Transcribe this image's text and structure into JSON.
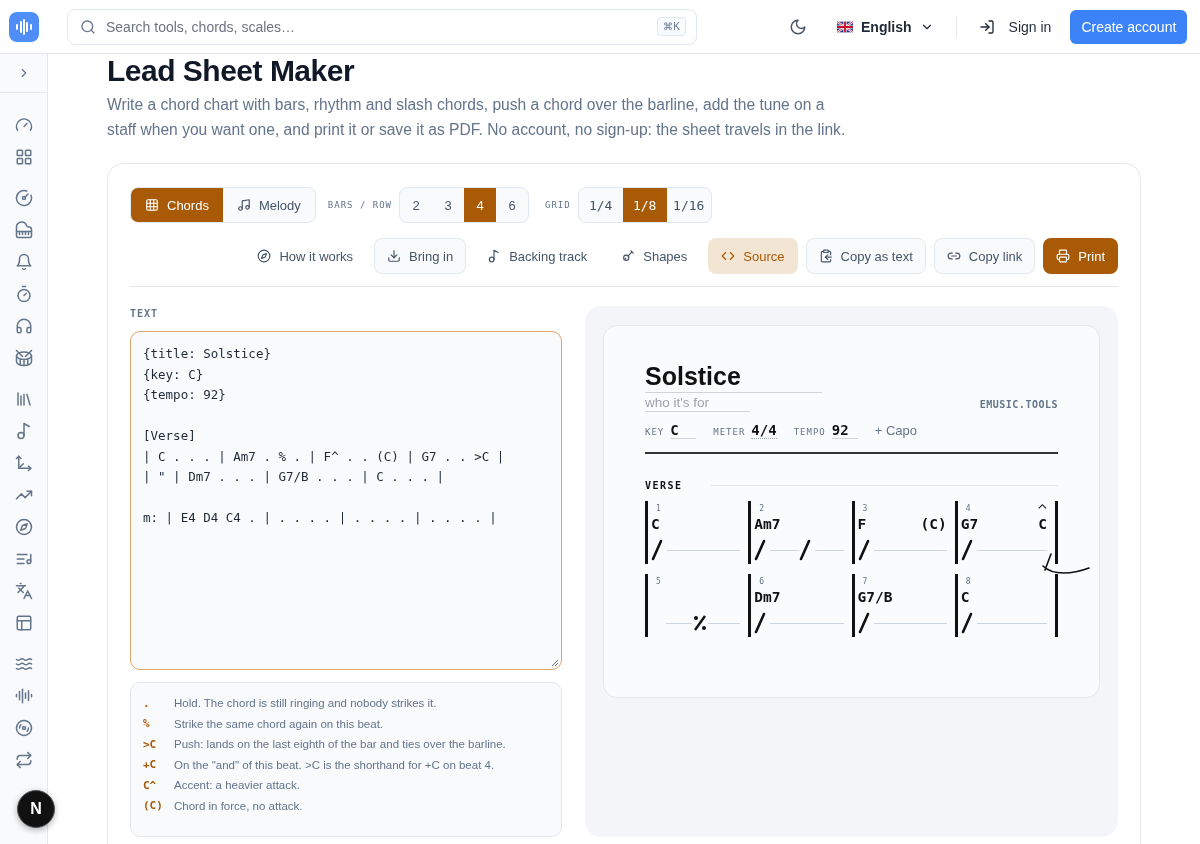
{
  "top_bar": {
    "search": {
      "placeholder": "Search tools, chords, scales…",
      "shortcut": "⌘K"
    },
    "language": "English",
    "sign_in": "Sign in",
    "create_account": "Create account"
  },
  "page": {
    "title": "Lead Sheet Maker",
    "description": "Write a chord chart with bars, rhythm and slash chords, push a chord over the barline, add the tune on a staff when you want one, and print it or save it as PDF. No account, no sign-up: the sheet travels in the link."
  },
  "mode_tabs": [
    {
      "label": "Chords",
      "selected": true
    },
    {
      "label": "Melody",
      "selected": false
    }
  ],
  "bars_per_row": {
    "label": "BARS / ROW",
    "options": [
      {
        "label": "2",
        "selected": false
      },
      {
        "label": "3",
        "selected": false
      },
      {
        "label": "4",
        "selected": true
      },
      {
        "label": "6",
        "selected": false
      }
    ]
  },
  "grid": {
    "label": "GRID",
    "options": [
      {
        "label": "1/4",
        "selected": false
      },
      {
        "label": "1/8",
        "selected": true
      },
      {
        "label": "1/16",
        "selected": false
      }
    ]
  },
  "actions": [
    {
      "label": "How it works",
      "kind": "plain"
    },
    {
      "label": "Bring in",
      "kind": "outline"
    },
    {
      "label": "Backing track",
      "kind": "plain"
    },
    {
      "label": "Shapes",
      "kind": "plain"
    },
    {
      "label": "Source",
      "kind": "active"
    },
    {
      "label": "Copy as text",
      "kind": "outline"
    },
    {
      "label": "Copy link",
      "kind": "outline"
    },
    {
      "label": "Print",
      "kind": "primary"
    }
  ],
  "editor": {
    "label": "TEXT",
    "source": "{title: Solstice}\n{key: C}\n{tempo: 92}\n\n[Verse]\n| C . . . | Am7 . % . | F^ . . (C) | G7 . . >C |\n| \" | Dm7 . . . | G7/B . . . | C . . . |\n\nm: | E4 D4 C4 . | . . . . | . . . . | . . . . |"
  },
  "legend": [
    {
      "symbol": ".",
      "text": "Hold. The chord is still ringing and nobody strikes it."
    },
    {
      "symbol": "%",
      "text": "Strike the same chord again on this beat."
    },
    {
      "symbol": ">C",
      "text": "Push: lands on the last eighth of the bar and ties over the barline."
    },
    {
      "symbol": "+C",
      "text": "On the \"and\" of this beat. >C is the shorthand for +C on beat 4."
    },
    {
      "symbol": "C^",
      "text": "Accent: a heavier attack."
    },
    {
      "symbol": "(C)",
      "text": "Chord in force, no attack."
    }
  ],
  "sheet": {
    "title": "Solstice",
    "subtitle_placeholder": "who it's for",
    "brand": "EMUSIC.TOOLS",
    "meta": [
      {
        "label": "KEY",
        "value": "C"
      },
      {
        "label": "METER",
        "value": "4/4"
      },
      {
        "label": "TEMPO",
        "value": "92"
      }
    ],
    "capo": "+ Capo",
    "section": "VERSE",
    "bars": [
      {
        "number": "1",
        "kind": "chords",
        "chords": [
          {
            "name": "C",
            "accent": false
          }
        ],
        "strikes": [
          true,
          false,
          false,
          false
        ],
        "push": false
      },
      {
        "number": "2",
        "kind": "chords",
        "chords": [
          {
            "name": "Am7",
            "accent": false
          }
        ],
        "strikes": [
          true,
          false,
          true,
          false
        ],
        "push": false
      },
      {
        "number": "3",
        "kind": "chords",
        "chords": [
          {
            "name": "F",
            "accent": false
          }
        ],
        "late_chords": [
          {
            "name": "(C)",
            "accent": false
          }
        ],
        "strikes": [
          true,
          false,
          false,
          false
        ],
        "push": false
      },
      {
        "number": "4",
        "kind": "chords",
        "chords": [
          {
            "name": "G7",
            "accent": false
          }
        ],
        "late_chords": [
          {
            "name": "C",
            "accent": true
          }
        ],
        "strikes": [
          true,
          false,
          false,
          false
        ],
        "push": true
      },
      {
        "number": "5",
        "kind": "repeat"
      },
      {
        "number": "6",
        "kind": "chords",
        "chords": [
          {
            "name": "Dm7",
            "accent": false
          }
        ],
        "strikes": [
          true,
          false,
          false,
          false
        ],
        "push": false
      },
      {
        "number": "7",
        "kind": "chords",
        "chords": [
          {
            "name": "G7/B",
            "accent": false
          }
        ],
        "strikes": [
          true,
          false,
          false,
          false
        ],
        "push": false
      },
      {
        "number": "8",
        "kind": "chords",
        "chords": [
          {
            "name": "C",
            "accent": false
          }
        ],
        "strikes": [
          true,
          false,
          false,
          false
        ],
        "push": false
      }
    ]
  },
  "dev_badge": "N"
}
